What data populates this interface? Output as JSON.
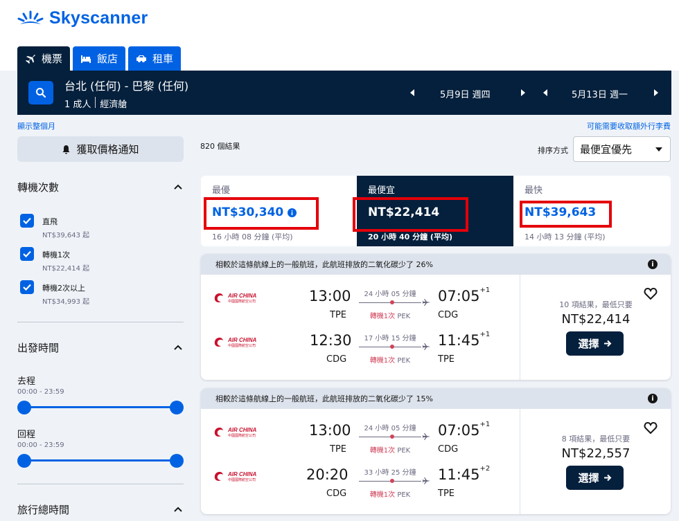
{
  "brand": {
    "name": "Skyscanner",
    "color": "#0062e3"
  },
  "tabs": [
    {
      "label": "機票",
      "icon": "plane-icon",
      "active": true
    },
    {
      "label": "飯店",
      "icon": "bed-icon",
      "active": false
    },
    {
      "label": "租車",
      "icon": "car-icon",
      "active": false
    }
  ],
  "search": {
    "route": "台北 (任何) - 巴黎 (任何)",
    "travellers": "1 成人",
    "cabin": "經濟艙",
    "depart_date": "5月9日 週四",
    "return_date": "5月13日 週一"
  },
  "links": {
    "whole_month": "顯示整個月",
    "extra_fees": "可能需要收取額外行李費"
  },
  "price_alert": "獲取價格通知",
  "filters": {
    "stops_title": "轉機次數",
    "stops": [
      {
        "label": "直飛",
        "price": "NT$39,643 起",
        "checked": true
      },
      {
        "label": "轉機1次",
        "price": "NT$22,414 起",
        "checked": true
      },
      {
        "label": "轉機2次以上",
        "price": "NT$34,993 起",
        "checked": true
      }
    ],
    "times_title": "出發時間",
    "outbound_label": "去程",
    "outbound_range": "00:00 - 23:59",
    "return_label": "回程",
    "return_range": "00:00 - 23:59",
    "duration_title": "旅行總時間"
  },
  "results_count": "820 個結果",
  "sort": {
    "label": "排序方式",
    "value": "最便宜優先"
  },
  "sort_tabs": [
    {
      "title": "最優",
      "price": "NT$30,340",
      "duration": "16 小時 08 分鐘 (平均)"
    },
    {
      "title": "最便宜",
      "price": "NT$22,414",
      "duration": "20 小時 40 分鐘 (平均)"
    },
    {
      "title": "最快",
      "price": "NT$39,643",
      "duration": "14 小時 13 分鐘 (平均)"
    }
  ],
  "cards": [
    {
      "eco": "相較於這條航線上的一般航班，此航班排放的二氧化碳少了 26%",
      "legs": [
        {
          "airline": "AIR CHINA",
          "airline_cn": "中國國際航空公司",
          "dep": "13:00",
          "dep_ap": "TPE",
          "arr": "07:05",
          "arr_plus": "+1",
          "arr_ap": "CDG",
          "duration": "24 小時 05 分鐘",
          "stops": "轉機1次",
          "via": "PEK"
        },
        {
          "airline": "AIR CHINA",
          "airline_cn": "中國國際航空公司",
          "dep": "12:30",
          "dep_ap": "CDG",
          "arr": "11:45",
          "arr_plus": "+1",
          "arr_ap": "TPE",
          "duration": "17 小時 15 分鐘",
          "stops": "轉機1次",
          "via": "PEK"
        }
      ],
      "deals": "10 項結果，最低只要",
      "price": "NT$22,414",
      "select": "選擇"
    },
    {
      "eco": "相較於這條航線上的一般航班，此航班排放的二氧化碳少了 15%",
      "legs": [
        {
          "airline": "AIR CHINA",
          "airline_cn": "中國國際航空公司",
          "dep": "13:00",
          "dep_ap": "TPE",
          "arr": "07:05",
          "arr_plus": "+1",
          "arr_ap": "CDG",
          "duration": "24 小時 05 分鐘",
          "stops": "轉機1次",
          "via": "PEK"
        },
        {
          "airline": "AIR CHINA",
          "airline_cn": "中國國際航空公司",
          "dep": "20:20",
          "dep_ap": "CDG",
          "arr": "11:45",
          "arr_plus": "+2",
          "arr_ap": "TPE",
          "duration": "33 小時 25 分鐘",
          "stops": "轉機1次",
          "via": "PEK"
        }
      ],
      "deals": "8 項結果，最低只要",
      "price": "NT$22,557",
      "select": "選擇"
    }
  ]
}
